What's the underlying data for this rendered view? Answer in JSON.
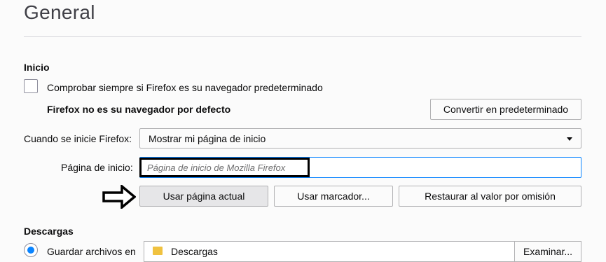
{
  "page": {
    "title": "General"
  },
  "startup": {
    "heading": "Inicio",
    "always_check_label": "Comprobar siempre si Firefox es su navegador predeterminado",
    "not_default_text": "Firefox no es su navegador por defecto",
    "make_default_button": "Convertir en predeterminado",
    "when_starts_label": "Cuando se inicie Firefox:",
    "when_starts_value": "Mostrar mi página de inicio",
    "homepage_label": "Página de inicio:",
    "homepage_placeholder": "Página de inicio de Mozilla Firefox",
    "use_current_button": "Usar página actual",
    "use_bookmark_button": "Usar marcador...",
    "restore_default_button": "Restaurar al valor por omisión"
  },
  "downloads": {
    "heading": "Descargas",
    "save_to_label": "Guardar archivos en",
    "folder_name": "Descargas",
    "browse_button": "Examinar..."
  },
  "colors": {
    "accent": "#0a84ff",
    "highlight_border": "#000000"
  },
  "icons": {
    "arrow": "right-arrow-icon",
    "folder": "folder-icon",
    "dropdown": "chevron-down-icon"
  }
}
